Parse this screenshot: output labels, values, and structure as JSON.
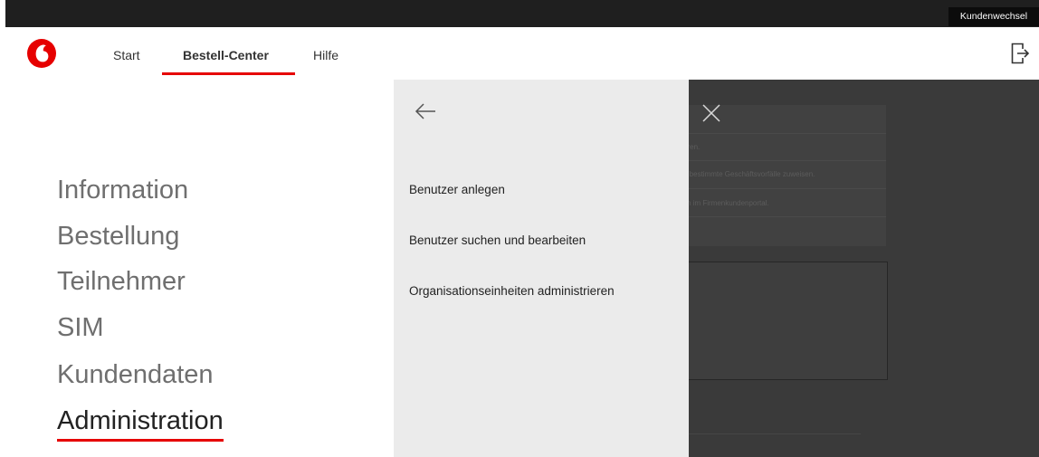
{
  "topbar": {
    "kundenwechsel_label": "Kundenwechsel"
  },
  "nav": {
    "start": "Start",
    "bestell_center": "Bestell-Center",
    "hilfe": "Hilfe"
  },
  "menu": {
    "items": [
      "Information",
      "Bestellung",
      "Teilnehmer",
      "SIM",
      "Kundendaten",
      "Administration"
    ],
    "active": "Administration"
  },
  "submenu": {
    "items": [
      "Benutzer anlegen",
      "Benutzer suchen und bearbeiten",
      "Organisationseinheiten administrieren"
    ]
  },
  "background": {
    "lines": [
      "hren.",
      "d bestimmte Geschäftsvorfälle zuweisen.",
      "ch im Firmenkundenportal."
    ]
  },
  "colors": {
    "brand_red": "#e60000",
    "topbar": "#1f1f1f",
    "overlay": "#3a3a3a",
    "submenu_bg": "#ebebeb"
  },
  "icons": {
    "logo": "vodafone-speech-mark",
    "logout": "logout-icon",
    "back": "arrow-left-icon",
    "close": "close-icon"
  }
}
